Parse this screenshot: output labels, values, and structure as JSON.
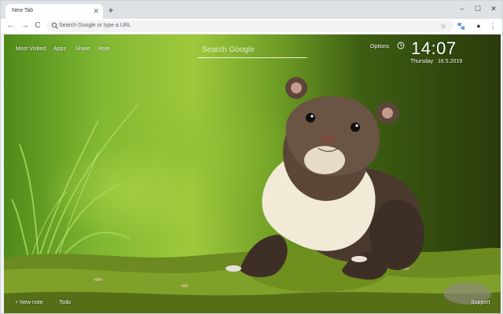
{
  "browser": {
    "tab_title": "New Tab",
    "tab_close_icon": "close-icon",
    "new_tab_symbol": "+",
    "window_controls": [
      "–",
      "☐",
      "✕"
    ],
    "back_symbol": "←",
    "forward_symbol": "→",
    "reload_symbol": "C",
    "omnibox_placeholder": "Search Google or type a URL",
    "star_symbol": "☆",
    "extension_symbol": "🐾",
    "profile_symbol": "●",
    "menu_symbol": "⋮"
  },
  "newtab": {
    "top_links": [
      "Most Visited",
      "Apps",
      "Share",
      "Rate"
    ],
    "search_placeholder": "Search Google",
    "options_label": "Options",
    "clock": {
      "time": "14:07",
      "weekday": "Thursday",
      "date": "16.5.2019"
    },
    "bottom_left": [
      "+ New note",
      "Todo"
    ],
    "bottom_right": "Support"
  },
  "colors": {
    "tabstrip": "#dee1e6",
    "toolbar": "#ffffff",
    "omnibox": "#f1f3f4",
    "overlay_text": "#ffffff"
  }
}
